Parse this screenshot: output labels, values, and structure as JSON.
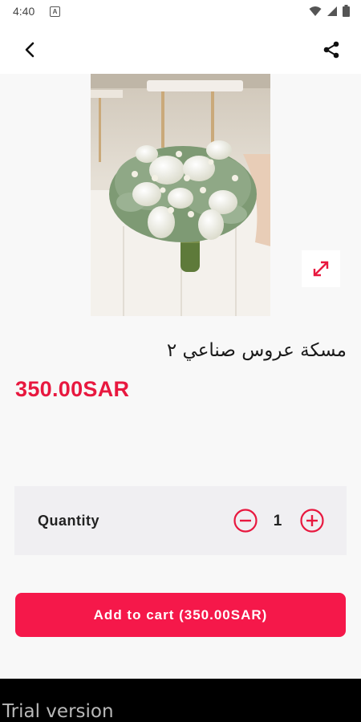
{
  "status_bar": {
    "time": "4:40",
    "notification_icon": "a-notification-icon",
    "icons": [
      "wifi-icon",
      "signal-icon",
      "battery-icon"
    ]
  },
  "app_bar": {
    "back_icon": "chevron-left-icon",
    "share_icon": "share-icon"
  },
  "product": {
    "image_icon": "bouquet-photo",
    "expand_icon": "expand-icon",
    "title": "مسكة عروس صناعي ٢",
    "price": "350.00SAR"
  },
  "quantity": {
    "label": "Quantity",
    "value": "1",
    "minus_icon": "minus-circle-icon",
    "plus_icon": "plus-circle-icon"
  },
  "cart": {
    "add_label": "Add to cart (350.00SAR)"
  },
  "footer": {
    "trial_text": "Trial version"
  },
  "colors": {
    "accent": "#f5184a",
    "price": "#e8183f",
    "qty_box": "#f0eff2"
  }
}
